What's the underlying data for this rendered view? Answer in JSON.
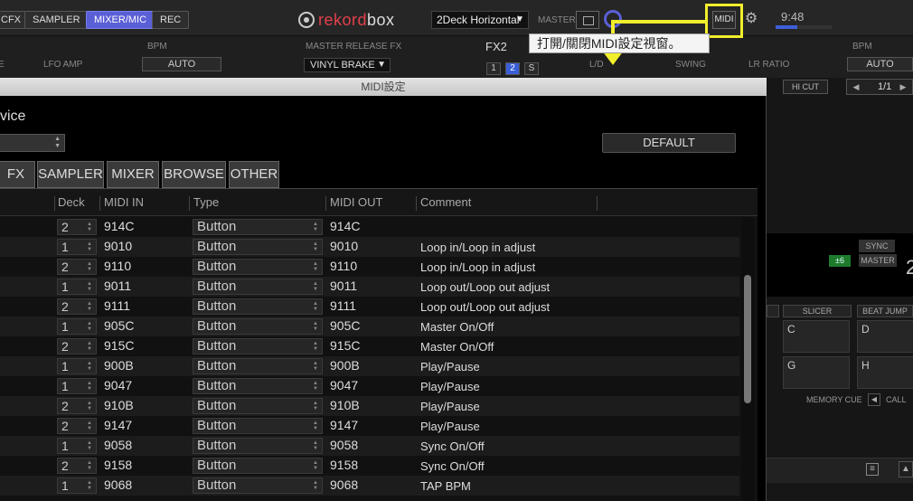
{
  "topbar": {
    "tabs": [
      {
        "label": "CFX",
        "active": false
      },
      {
        "label": "SAMPLER",
        "active": false
      },
      {
        "label": "MIXER/MIC",
        "active": true
      },
      {
        "label": "REC",
        "active": false
      }
    ],
    "logo": {
      "part1": "rekord",
      "part2": "box"
    },
    "layout": "2Deck Horizontal",
    "master_label": "MASTER",
    "midi_label": "MIDI",
    "clock": "9:48",
    "clock_fill_pct": 38
  },
  "tooltip": "打開/關閉MIDI設定視窗。",
  "strip": {
    "fx_left": "E",
    "lfo_amp": "LFO AMP",
    "bpm_left": "BPM",
    "auto_left": "AUTO",
    "master_release_fx": "MASTER RELEASE FX",
    "vinyl_brake": "VINYL BRAKE",
    "fx2": "FX2",
    "fx_slots": [
      "1",
      "2",
      "S"
    ],
    "ld": "L/D",
    "swing": "SWING",
    "lr_ratio": "LR RATIO",
    "bpm_right": "BPM",
    "auto_right": "AUTO"
  },
  "right_panel": {
    "hi_cut": "HI CUT",
    "pager": "1/1",
    "sync": "SYNC",
    "master": "MASTER",
    "pitch_range": "±6",
    "deck_num": "2",
    "modes": [
      "SLICER",
      "BEAT JUMP"
    ],
    "pads": [
      "C",
      "D",
      "G",
      "H"
    ],
    "memory_cue": "MEMORY CUE",
    "call": "CALL"
  },
  "dialog": {
    "title": "MIDI設定",
    "device_label": "vice",
    "default_button": "DEFAULT",
    "category_tabs": [
      "FX",
      "SAMPLER",
      "MIXER",
      "BROWSE",
      "OTHER"
    ],
    "columns": {
      "deck": "Deck",
      "midi_in": "MIDI IN",
      "type": "Type",
      "midi_out": "MIDI OUT",
      "comment": "Comment"
    },
    "rows": [
      {
        "deck": "2",
        "midi_in": "914C",
        "type": "Button",
        "midi_out": "914C",
        "comment": ""
      },
      {
        "deck": "1",
        "midi_in": "9010",
        "type": "Button",
        "midi_out": "9010",
        "comment": "Loop in/Loop in adjust"
      },
      {
        "deck": "2",
        "midi_in": "9110",
        "type": "Button",
        "midi_out": "9110",
        "comment": "Loop in/Loop in adjust"
      },
      {
        "deck": "1",
        "midi_in": "9011",
        "type": "Button",
        "midi_out": "9011",
        "comment": "Loop out/Loop out adjust"
      },
      {
        "deck": "2",
        "midi_in": "9111",
        "type": "Button",
        "midi_out": "9111",
        "comment": "Loop out/Loop out adjust"
      },
      {
        "deck": "1",
        "midi_in": "905C",
        "type": "Button",
        "midi_out": "905C",
        "comment": "Master On/Off"
      },
      {
        "deck": "2",
        "midi_in": "915C",
        "type": "Button",
        "midi_out": "915C",
        "comment": "Master On/Off"
      },
      {
        "deck": "1",
        "midi_in": "900B",
        "type": "Button",
        "midi_out": "900B",
        "comment": "Play/Pause"
      },
      {
        "deck": "1",
        "midi_in": "9047",
        "type": "Button",
        "midi_out": "9047",
        "comment": "Play/Pause"
      },
      {
        "deck": "2",
        "midi_in": "910B",
        "type": "Button",
        "midi_out": "910B",
        "comment": "Play/Pause"
      },
      {
        "deck": "2",
        "midi_in": "9147",
        "type": "Button",
        "midi_out": "9147",
        "comment": "Play/Pause"
      },
      {
        "deck": "1",
        "midi_in": "9058",
        "type": "Button",
        "midi_out": "9058",
        "comment": "Sync On/Off"
      },
      {
        "deck": "2",
        "midi_in": "9158",
        "type": "Button",
        "midi_out": "9158",
        "comment": "Sync On/Off"
      },
      {
        "deck": "1",
        "midi_in": "9068",
        "type": "Button",
        "midi_out": "9068",
        "comment": "TAP BPM"
      }
    ]
  }
}
